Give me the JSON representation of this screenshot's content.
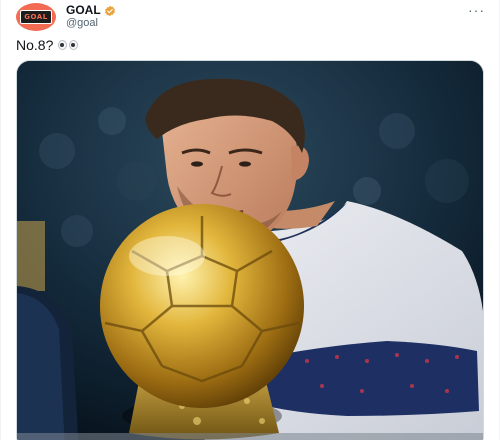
{
  "account": {
    "display_name": "GOAL",
    "handle": "@goal",
    "avatar_text": "GOAL",
    "verified": true
  },
  "tweet": {
    "text": "No.8?",
    "emoji": "eyes"
  },
  "icons": {
    "verified": "verified-badge-icon",
    "more": "more-options-icon"
  },
  "colors": {
    "avatar_bg": "#f26b52",
    "verified": "#e8a33a",
    "text": "#0f1419",
    "muted": "#536471"
  }
}
